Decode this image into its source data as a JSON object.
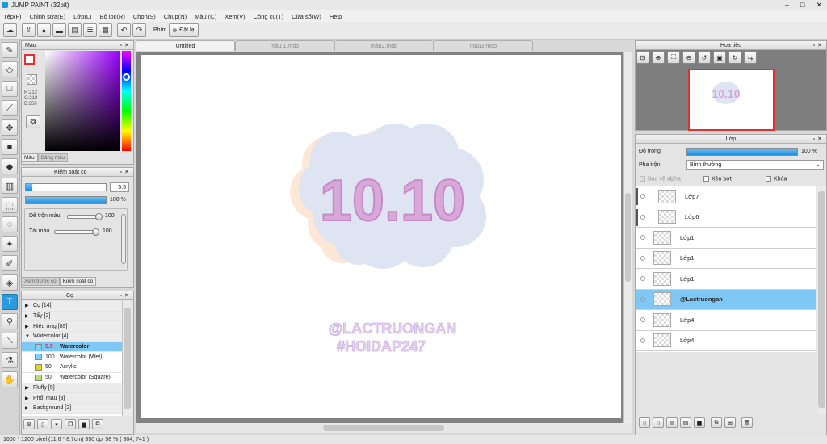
{
  "window": {
    "title": "JUMP PAINT (32bit)",
    "controls": [
      "–",
      "□",
      "✕"
    ]
  },
  "menu": [
    "Tệp(F)",
    "Chỉnh sửa(E)",
    "Lớp(L)",
    "Bộ lọc(R)",
    "Chọn(S)",
    "Chụp(N)",
    "Màu (C)",
    "Xem(V)",
    "Công cụ(T)",
    "Cửa sổ(W)",
    "Help"
  ],
  "toolbar": {
    "key_label": "Phím",
    "reset_label": "Đặt lại"
  },
  "color_panel": {
    "title": "Màu",
    "r": "R:212",
    "g": "G:218",
    "b": "B:250",
    "tabs": [
      "Màu",
      "Bảng màu"
    ]
  },
  "brush_control": {
    "title": "Kiểm soát cọ",
    "size_value": "5.5",
    "opacity_label": "100 %",
    "opacity": 1.0,
    "size_fill": 0.08,
    "mix_label": "Dễ trộn màu",
    "mix_value": "100",
    "mix_level": 1.0,
    "refill_label": "Tải màu",
    "refill_value": "100",
    "refill_level": 1.0,
    "tabs": [
      "Xem trước cọ",
      "Kiểm soát cọ"
    ]
  },
  "brush_panel": {
    "title": "Cọ",
    "items": [
      {
        "kind": "cat",
        "arrow": "▶",
        "label": "Cọ [14]"
      },
      {
        "kind": "cat",
        "arrow": "▶",
        "label": "Tẩy [2]"
      },
      {
        "kind": "cat",
        "arrow": "▶",
        "label": "Hiệu ứng [89]"
      },
      {
        "kind": "cat",
        "arrow": "▼",
        "label": "Watercolor [4]"
      },
      {
        "kind": "brush",
        "size": "5.5",
        "label": "Watercolor",
        "color": "#7fd0f5",
        "selected": true
      },
      {
        "kind": "brush",
        "size": "100",
        "label": "Watercolor (Wet)",
        "color": "#7fd0f5"
      },
      {
        "kind": "brush",
        "size": "50",
        "label": "Acrylic",
        "color": "#e8d800"
      },
      {
        "kind": "brush",
        "size": "50",
        "label": "Watercolor (Square)",
        "color": "#b8e06a"
      },
      {
        "kind": "cat",
        "arrow": "▶",
        "label": "Fluffy [5]"
      },
      {
        "kind": "cat",
        "arrow": "▶",
        "label": "Phối màu [3]"
      },
      {
        "kind": "cat",
        "arrow": "▶",
        "label": "Background [2]"
      }
    ]
  },
  "doc_tabs": [
    "Untitled",
    "màu 1.mdp",
    "màu2.mdp",
    "màu3.mdp"
  ],
  "artwork": {
    "headline": "10.10",
    "handle": "@LACTRUONGAN",
    "tag": "#HOIDAP247"
  },
  "navigator": {
    "title": "Hoa tiêu"
  },
  "layer_panel": {
    "title": "Lớp",
    "opacity_label": "Độ trong",
    "opacity_value": "100 %",
    "opacity": 1.0,
    "blend_label": "Pha trộn",
    "blend_value": "Bình thường",
    "alpha_label": "Bảo vệ alpha",
    "clip_label": "Xén bớt",
    "lock_label": "Khóa",
    "layers": [
      {
        "name": "Lớp7",
        "clipped": true
      },
      {
        "name": "Lớp6",
        "clipped": true
      },
      {
        "name": "Lớp1"
      },
      {
        "name": "Lớp1"
      },
      {
        "name": "Lớp1"
      },
      {
        "name": "@Lactruongan",
        "selected": true
      },
      {
        "name": "Lớp4"
      },
      {
        "name": "Lớp4"
      }
    ]
  },
  "status": {
    "text": "1600 * 1200 pixel   (11.6 * 8.7cm)   350 dpi   58 %   ( 304, 741 )"
  },
  "colors": {
    "accent": "#2b9be0",
    "selection": "#7fc8f5",
    "fg_swatch_border": "#e03030"
  }
}
